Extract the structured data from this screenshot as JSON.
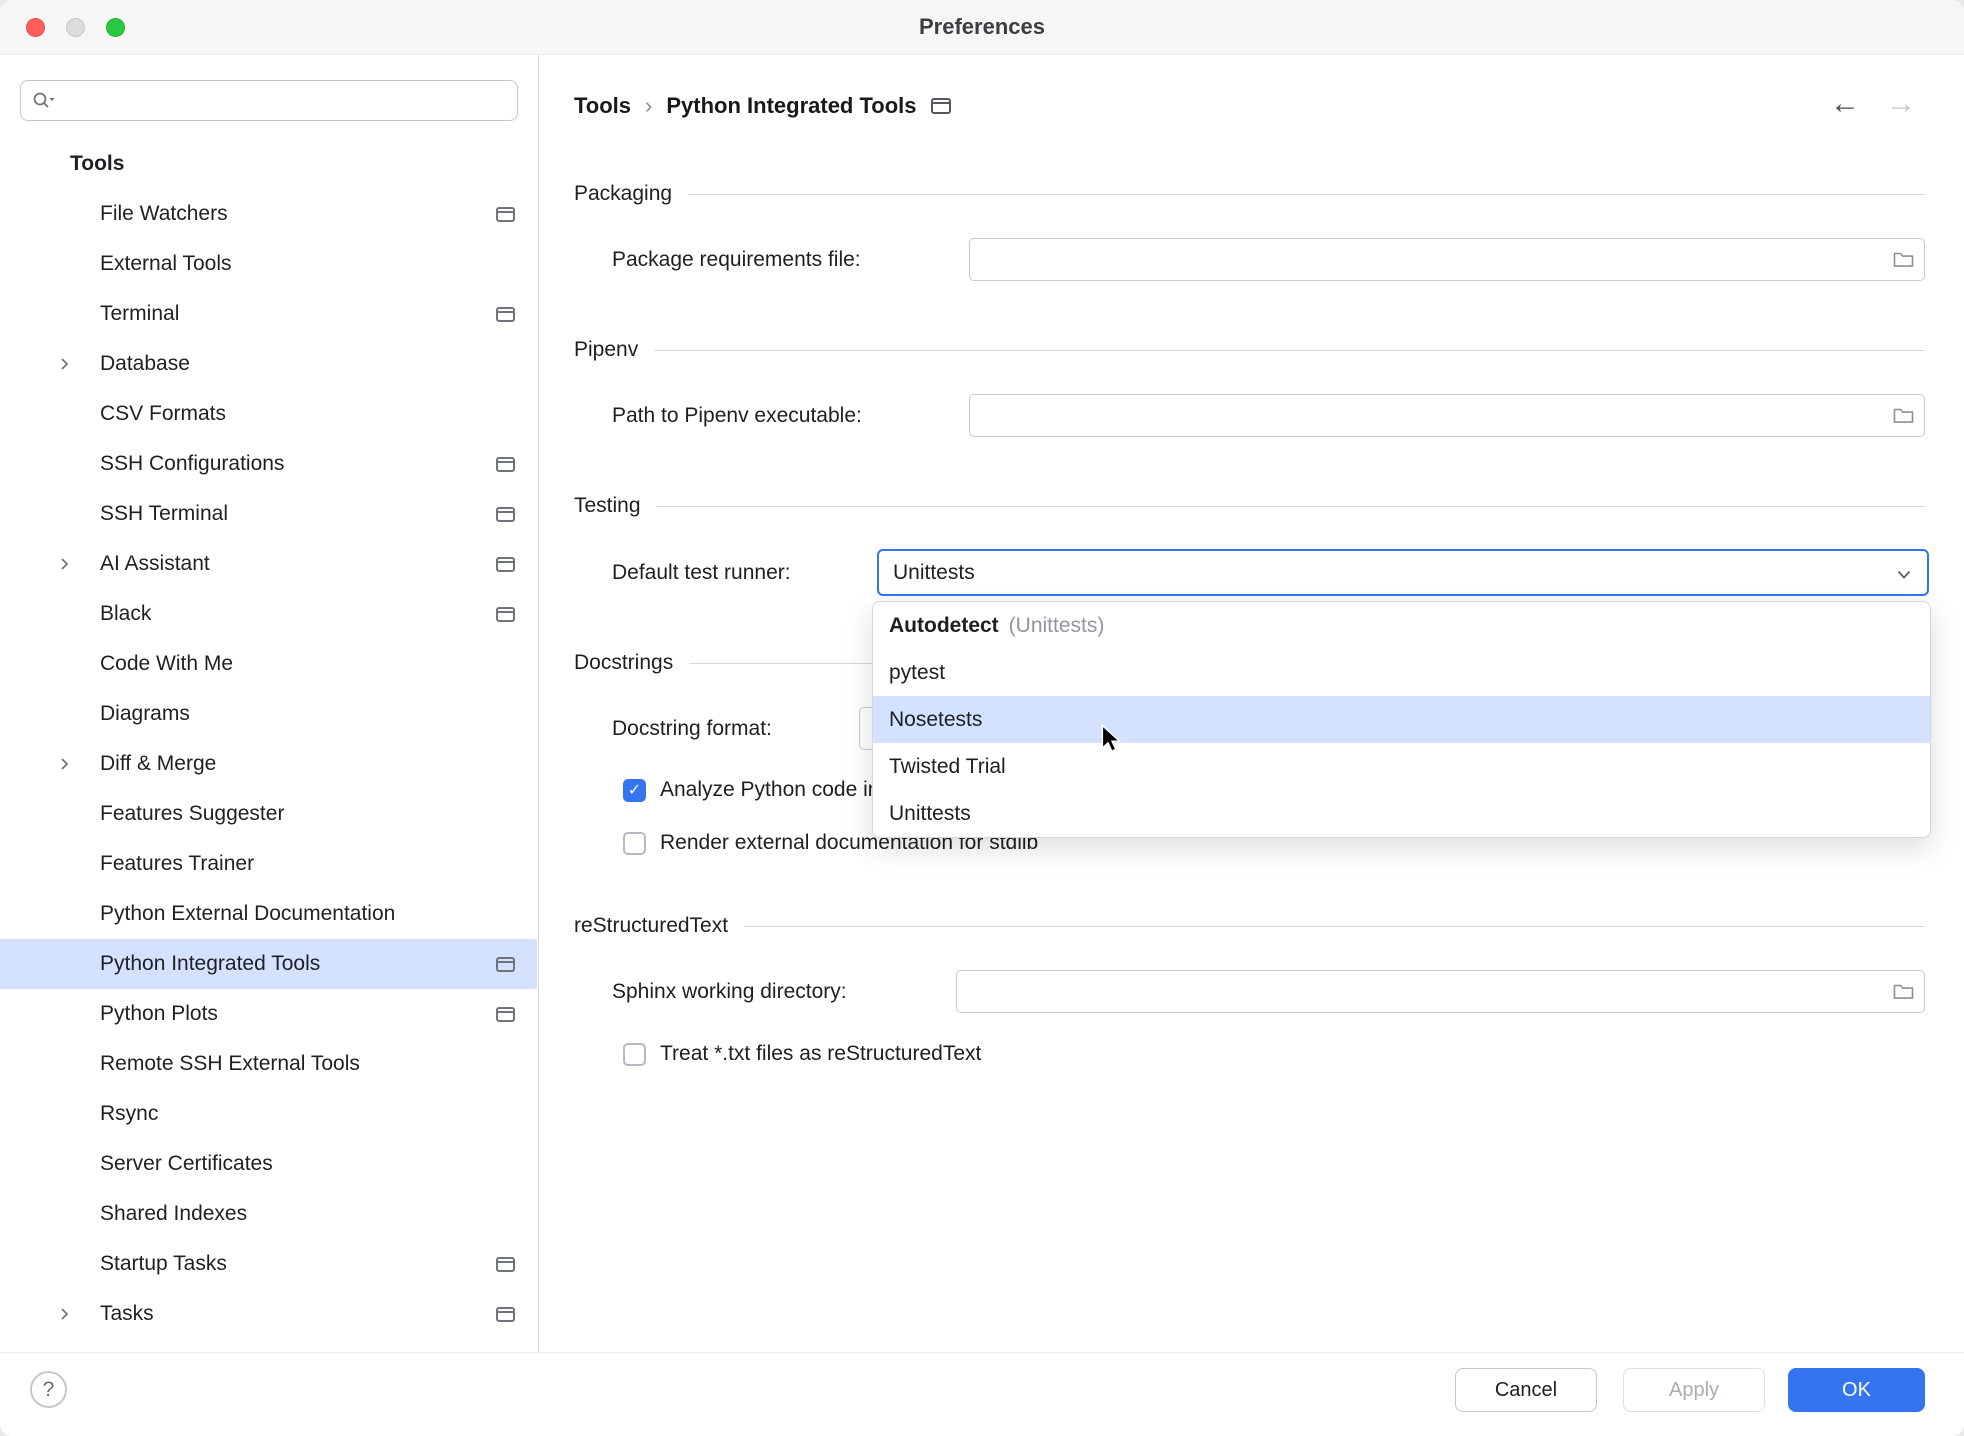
{
  "window": {
    "title": "Preferences"
  },
  "search": {
    "placeholder": ""
  },
  "sidebar": {
    "header": "Tools",
    "selected": "Python Integrated Tools",
    "items": [
      {
        "label": "File Watchers",
        "tool_icon": true,
        "chevron": false
      },
      {
        "label": "External Tools",
        "tool_icon": false,
        "chevron": false
      },
      {
        "label": "Terminal",
        "tool_icon": true,
        "chevron": false
      },
      {
        "label": "Database",
        "tool_icon": false,
        "chevron": true
      },
      {
        "label": "CSV Formats",
        "tool_icon": false,
        "chevron": false
      },
      {
        "label": "SSH Configurations",
        "tool_icon": true,
        "chevron": false
      },
      {
        "label": "SSH Terminal",
        "tool_icon": true,
        "chevron": false
      },
      {
        "label": "AI Assistant",
        "tool_icon": true,
        "chevron": true
      },
      {
        "label": "Black",
        "tool_icon": true,
        "chevron": false
      },
      {
        "label": "Code With Me",
        "tool_icon": false,
        "chevron": false
      },
      {
        "label": "Diagrams",
        "tool_icon": false,
        "chevron": false
      },
      {
        "label": "Diff & Merge",
        "tool_icon": false,
        "chevron": true
      },
      {
        "label": "Features Suggester",
        "tool_icon": false,
        "chevron": false
      },
      {
        "label": "Features Trainer",
        "tool_icon": false,
        "chevron": false
      },
      {
        "label": "Python External Documentation",
        "tool_icon": false,
        "chevron": false
      },
      {
        "label": "Python Integrated Tools",
        "tool_icon": true,
        "chevron": false
      },
      {
        "label": "Python Plots",
        "tool_icon": true,
        "chevron": false
      },
      {
        "label": "Remote SSH External Tools",
        "tool_icon": false,
        "chevron": false
      },
      {
        "label": "Rsync",
        "tool_icon": false,
        "chevron": false
      },
      {
        "label": "Server Certificates",
        "tool_icon": false,
        "chevron": false
      },
      {
        "label": "Shared Indexes",
        "tool_icon": false,
        "chevron": false
      },
      {
        "label": "Startup Tasks",
        "tool_icon": true,
        "chevron": false
      },
      {
        "label": "Tasks",
        "tool_icon": true,
        "chevron": true
      }
    ]
  },
  "breadcrumb": {
    "root": "Tools",
    "separator": "›",
    "current": "Python Integrated Tools"
  },
  "nav": {
    "back": "←",
    "forward": "→"
  },
  "sections": {
    "packaging": {
      "title": "Packaging",
      "requirements_label": "Package requirements file:",
      "requirements_value": ""
    },
    "pipenv": {
      "title": "Pipenv",
      "path_label": "Path to Pipenv executable:",
      "path_value": ""
    },
    "testing": {
      "title": "Testing",
      "runner_label": "Default test runner:",
      "runner_value": "Unittests"
    },
    "docstrings": {
      "title": "Docstrings",
      "format_label": "Docstring format:",
      "analyze_checkbox": "Analyze Python code in docstrings",
      "analyze_checked": true,
      "render_checkbox": "Render external documentation for stdlib",
      "render_checked": false
    },
    "restructuredtext": {
      "title": "reStructuredText",
      "sphinx_label": "Sphinx working directory:",
      "sphinx_value": "",
      "treat_checkbox": "Treat *.txt files as reStructuredText",
      "treat_checked": false
    }
  },
  "dropdown": {
    "highlighted": "Nosetests",
    "items": [
      {
        "label": "Autodetect",
        "note": "(Unittests)"
      },
      {
        "label": "pytest",
        "note": ""
      },
      {
        "label": "Nosetests",
        "note": ""
      },
      {
        "label": "Twisted Trial",
        "note": ""
      },
      {
        "label": "Unittests",
        "note": ""
      }
    ]
  },
  "footer": {
    "help": "?",
    "cancel": "Cancel",
    "apply": "Apply",
    "ok": "OK"
  }
}
